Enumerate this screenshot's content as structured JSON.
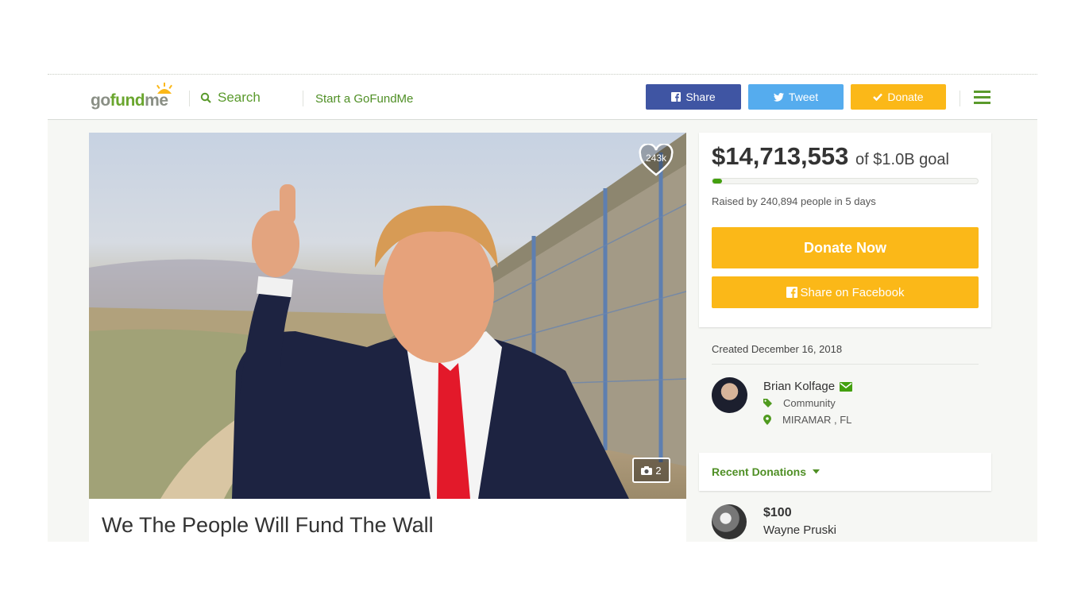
{
  "header": {
    "logo_go": "go",
    "logo_fund": "fund",
    "logo_me": "me",
    "search_label": "Search",
    "start_label": "Start a GoFundMe",
    "share_label": "Share",
    "tweet_label": "Tweet",
    "donate_label": "Donate"
  },
  "hero": {
    "hearts_count": "243k",
    "photo_count": "2"
  },
  "campaign": {
    "title": "We The People Will Fund The Wall",
    "raised_amount": "$14,713,553",
    "goal_text": "of $1.0B goal",
    "progress_fraction": 0.015,
    "raised_by": "Raised by 240,894 people in 5 days",
    "donate_now_label": "Donate Now",
    "share_facebook_label": "Share on Facebook",
    "created": "Created December 16, 2018"
  },
  "organizer": {
    "name": "Brian Kolfage",
    "category": "Community",
    "location": "MIRAMAR , FL"
  },
  "recent_donations": {
    "label": "Recent Donations",
    "items": [
      {
        "amount": "$100",
        "name": "Wayne Pruski"
      }
    ]
  },
  "colors": {
    "green": "#5a9a2c",
    "facebook_blue": "#3f55a3",
    "twitter_blue": "#55acee",
    "donate_yellow": "#fbb818",
    "progress_green": "#439f0f"
  }
}
